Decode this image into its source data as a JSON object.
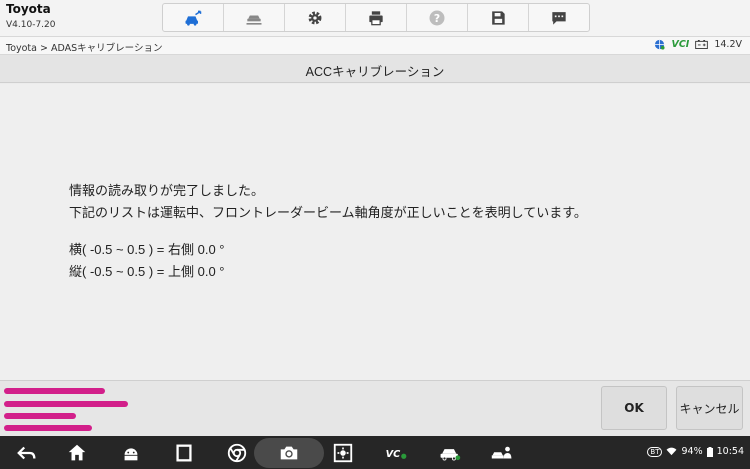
{
  "header": {
    "app_title": "Toyota",
    "version": "V4.10-7.20"
  },
  "toolbar": {
    "items": [
      {
        "icon": "car-share-icon",
        "active": true
      },
      {
        "icon": "car-lift-icon",
        "active": false
      },
      {
        "icon": "gear-icon",
        "active": false
      },
      {
        "icon": "printer-icon",
        "active": false
      },
      {
        "icon": "help-icon",
        "active": false
      },
      {
        "icon": "save-icon",
        "active": false
      },
      {
        "icon": "message-icon",
        "active": false
      }
    ]
  },
  "breadcrumb": {
    "text": "Toyota > ADASキャリブレーション"
  },
  "status": {
    "vci_label": "VCI",
    "voltage": "14.2V"
  },
  "page": {
    "title": "ACCキャリブレーション"
  },
  "message": {
    "line1": "情報の読み取りが完了しました。",
    "line2": "下記のリストは運転中、フロントレーダービーム軸角度が正しいことを表明しています。",
    "line3": "横( -0.5 ~ 0.5 ) = 右側 0.0 °",
    "line4": "縦( -0.5 ~ 0.5 ) = 上側 0.0 °"
  },
  "footer": {
    "ok_label": "OK",
    "cancel_label": "キャンセル"
  },
  "system": {
    "battery": "94%",
    "time": "10:54",
    "bt_label": "BT",
    "vci_nav_label": "VCI"
  },
  "colors": {
    "accent": "#1f6fd6",
    "redaction": "#d21f8a",
    "vci_green": "#2a9a3a"
  }
}
